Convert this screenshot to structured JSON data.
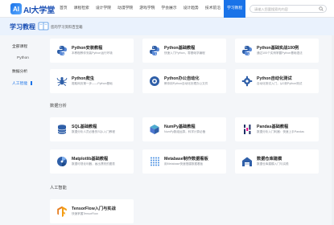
{
  "header": {
    "logo_text": "AI大学堂",
    "logo_mark": "AI",
    "nav": [
      "首页",
      "课程检索",
      "设计学院",
      "动漫学院",
      "游戏学院",
      "学会展示",
      "设计趋势",
      "技术前沿",
      "学习教程"
    ],
    "active_nav_index": 8,
    "search_placeholder": "请输入您要搜索的内容"
  },
  "page": {
    "title": "学习教程",
    "subtitle": "您的学习资料百宝箱"
  },
  "sidebar": {
    "items": [
      {
        "label": "全部课程",
        "active": false,
        "sub": false
      },
      {
        "label": "Python",
        "active": false,
        "sub": true
      },
      {
        "label": "数据分析",
        "active": false,
        "sub": false
      },
      {
        "label": "人工智能",
        "active": true,
        "sub": false
      }
    ]
  },
  "sections": [
    {
      "title": "",
      "cards": [
        {
          "title": "Python安装教程",
          "desc": "本教程教你安装Python运行环境",
          "icon": "python-icon",
          "color": "#2f5fa8"
        },
        {
          "title": "Python基础教程",
          "desc": "快速入门Python，零基础学编程",
          "icon": "python-icon",
          "color": "#2f5fa8"
        },
        {
          "title": "Python基础实战100例",
          "desc": "通过100个实例掌握Python基础语法",
          "icon": "python-icon",
          "color": "#2f5fa8"
        },
        {
          "title": "Python爬虫",
          "desc": "爬取网页第一步——Python基础",
          "icon": "spider-icon",
          "color": "#2f5fa8"
        },
        {
          "title": "Python办公自动化",
          "desc": "教你用Python自动化处理办公文件",
          "icon": "office-icon",
          "color": "#2f5fa8"
        },
        {
          "title": "Python自动化测试",
          "desc": "自动化测试入门，从0到Python测试",
          "icon": "gear-icon",
          "color": "#2f5fa8"
        }
      ]
    },
    {
      "title": "数据分析",
      "cards": [
        {
          "title": "SQL基础教程",
          "desc": "数据分析人员必备的SQL入门教程",
          "icon": "database-icon",
          "color": "#2f5fa8"
        },
        {
          "title": "NumPy基础教程",
          "desc": "NumPy数组运算，科学计算必备",
          "icon": "numpy-icon",
          "color": "#27a0d6"
        },
        {
          "title": "Pandas基础教程",
          "desc": "数据分析入门利器：快速上手Pandas",
          "icon": "pandas-icon",
          "color": "#1d2f66"
        },
        {
          "title": "Matplotlib基础教程",
          "desc": "数据可视化利器，画出漂亮的图表",
          "icon": "matplotlib-icon",
          "color": "#2f5fa8"
        },
        {
          "title": "Metabase制作数据看板",
          "desc": "用Metabase快速搭建数据看板",
          "icon": "metabase-icon",
          "color": "#4a90e2"
        },
        {
          "title": "数据仓库建模",
          "desc": "数据仓库建模入门与实践",
          "icon": "warehouse-icon",
          "color": "#2f5fa8"
        }
      ]
    },
    {
      "title": "人工智能",
      "cards": [
        {
          "title": "TensorFlow入门与实战",
          "desc": "快速掌握TensorFlow",
          "icon": "tensorflow-icon",
          "color": "#f39c12"
        }
      ]
    }
  ]
}
